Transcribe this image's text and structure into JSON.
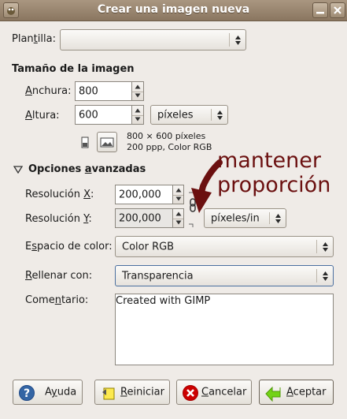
{
  "window": {
    "title": "Crear una imagen nueva"
  },
  "template": {
    "label_pre": "Plan",
    "label_u": "t",
    "label_post": "illa:",
    "value": ""
  },
  "image_size": {
    "heading": "Tamaño de la imagen",
    "width_label_u": "A",
    "width_label_post": "nchura:",
    "width_value": "800",
    "height_label_u": "A",
    "height_label_post": "ltura:",
    "height_value": "600",
    "unit": "píxeles",
    "info_line1": "800 × 600 píxeles",
    "info_line2": "200 ppp, Color RGB"
  },
  "advanced": {
    "heading_pre": "Opciones ",
    "heading_u": "a",
    "heading_post": "vanzadas",
    "res_x_label_pre": "Resolución ",
    "res_x_label_u": "X",
    "res_x_label_post": ":",
    "res_x_value": "200,000",
    "res_y_label_pre": "Resolución ",
    "res_y_label_u": "Y",
    "res_y_label_post": ":",
    "res_y_value": "200,000",
    "res_unit": "píxeles/in",
    "colorspace_label_pre": "E",
    "colorspace_label_u": "s",
    "colorspace_label_post": "pacio de color:",
    "colorspace_value": "Color RGB",
    "fill_label_u": "R",
    "fill_label_post": "ellenar con:",
    "fill_value": "Transparencia",
    "comment_label_pre": "Come",
    "comment_label_u": "n",
    "comment_label_post": "tario:",
    "comment_value": "Created with GIMP"
  },
  "annotation": {
    "line1": "mantener",
    "line2": "proporción",
    "color": "#6b1010"
  },
  "buttons": {
    "help": "A",
    "help_u": "y",
    "help_rest": "uda",
    "reset_u": "R",
    "reset_rest": "einiciar",
    "cancel_u": "C",
    "cancel_rest": "ancelar",
    "ok_u": "A",
    "ok_rest": "ceptar"
  },
  "icons": [
    "gimp-wilber-icon",
    "minimize-icon",
    "close-icon",
    "portrait-icon",
    "landscape-icon",
    "chain-link-icon",
    "expander-arrow-icon",
    "help-icon",
    "reset-icon",
    "cancel-icon",
    "ok-icon"
  ]
}
